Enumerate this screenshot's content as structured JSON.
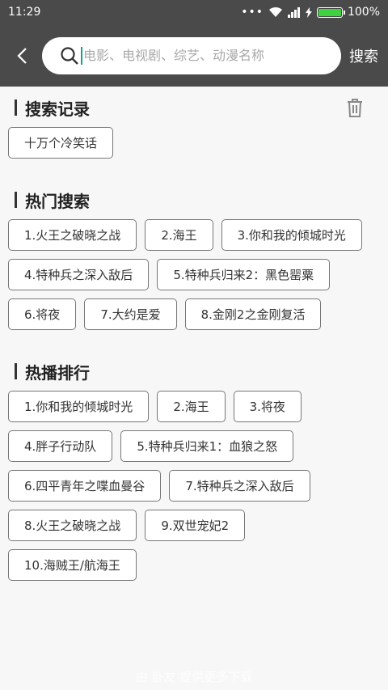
{
  "status_bar": {
    "time": "11:29",
    "dots": "•••",
    "battery_percent": "100%",
    "battery_level": 1.0
  },
  "header": {
    "back_icon": "chevron-left-icon",
    "search_icon": "search-icon",
    "search_placeholder": "电影、电视剧、综艺、动漫名称",
    "search_value": "",
    "search_button": "搜索"
  },
  "history": {
    "title": "搜索记录",
    "clear_icon": "trash-icon",
    "items": [
      "十万个冷笑话"
    ]
  },
  "hot_search": {
    "title": "热门搜索",
    "items": [
      "1.火王之破晓之战",
      "2.海王",
      "3.你和我的倾城时光",
      "4.特种兵之深入敌后",
      "5.特种兵归来2：黑色罂粟",
      "6.将夜",
      "7.大约是爱",
      "8.金刚2之金刚复活"
    ]
  },
  "hot_play": {
    "title": "热播排行",
    "items": [
      "1.你和我的倾城时光",
      "2.海王",
      "3.将夜",
      "4.胖子行动队",
      "5.特种兵归来1：血狼之怒",
      "6.四平青年之喋血曼谷",
      "7.特种兵之深入敌后",
      "8.火王之破晓之战",
      "9.双世宠妃2",
      "10.海贼王/航海王"
    ]
  },
  "watermark": "由 卧友 提供更多下载",
  "colors": {
    "header_bg": "#4a4a4a",
    "accent": "#1a9e8c",
    "battery": "#3fd23f"
  }
}
